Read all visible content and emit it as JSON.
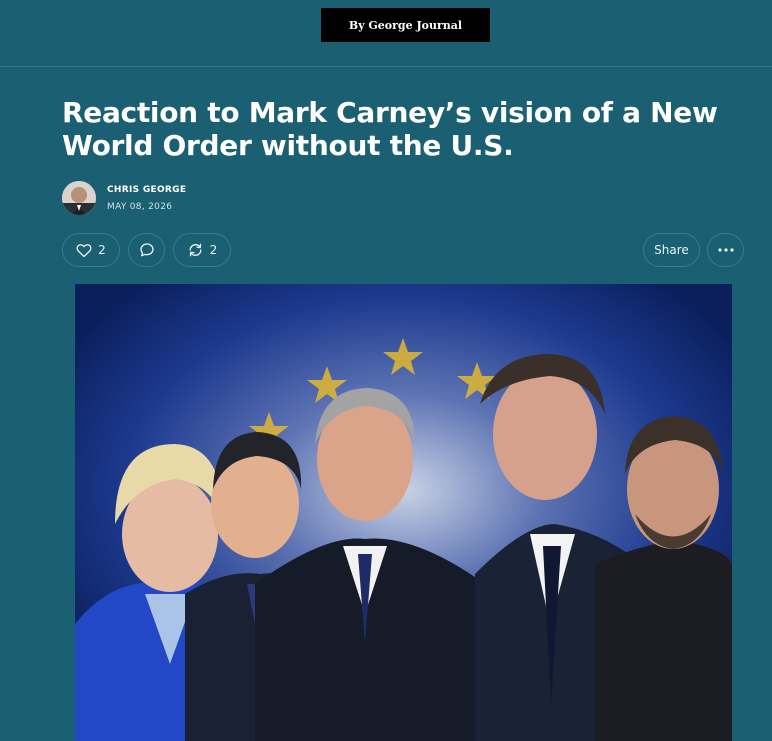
{
  "publication": {
    "name": "By George Journal"
  },
  "post": {
    "title": "Reaction to Mark Carney’s vision of a New World Order without the U.S.",
    "author": "CHRIS GEORGE",
    "date": "MAY 08, 2026"
  },
  "actions": {
    "likes": "2",
    "restacks": "2",
    "share_label": "Share"
  },
  "colors": {
    "background": "#1b5f72",
    "logo_bg": "#000000",
    "pill_border": "#3a7b8e",
    "hero_blue": "#0b2a7a"
  },
  "icons": {
    "like": "heart-icon",
    "comment": "comment-bubble-icon",
    "restack": "restack-arrows-icon",
    "more": "ellipsis-icon"
  }
}
